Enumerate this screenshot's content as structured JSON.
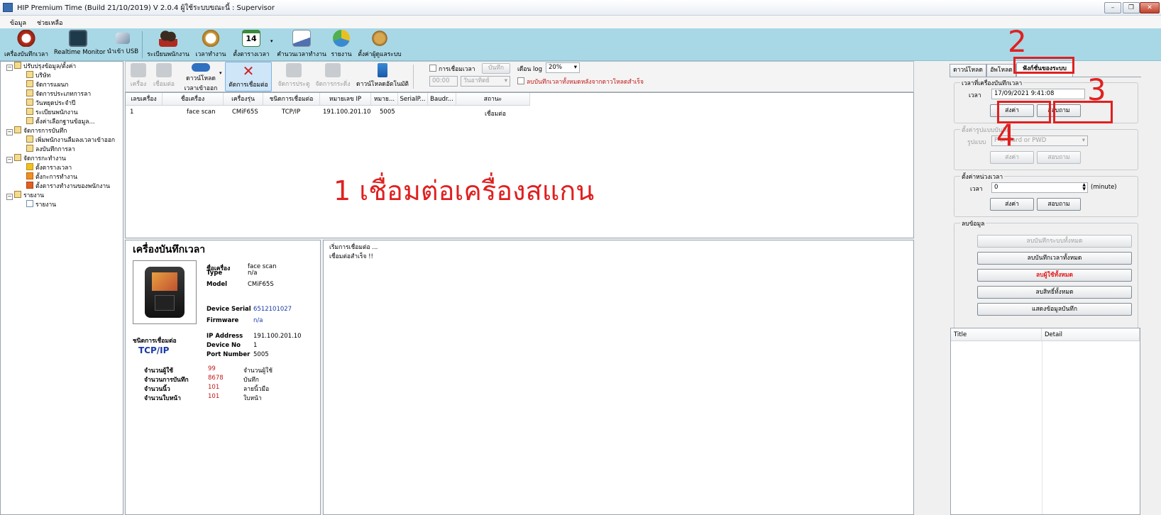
{
  "window": {
    "title": "HIP Premium Time (Build 21/10/2019) V 2.0.4  ผู้ใช้ระบบขณะนี้ : Supervisor",
    "min": "–",
    "max": "❐",
    "close": "✕"
  },
  "menu": [
    "ข้อมูล",
    "ช่วยเหลือ"
  ],
  "toolbar": [
    "เครื่องบันทึกเวลา",
    "Realtime Monitor",
    "นำเข้า USB",
    "ระเบียนพนักงาน",
    "เวลาทำงาน",
    "ตั้งตารางเวลา",
    "คำนวนเวลาทำงาน",
    "รายงาน",
    "ตั้งค่าผู้ดูแลระบบ"
  ],
  "toolbar_badge": "14",
  "tree": [
    {
      "label": "ปรับปรุงข้อมูล/ตั้งค่า",
      "level": 0
    },
    {
      "label": "บริษัท",
      "level": 1
    },
    {
      "label": "จัดการแผนก",
      "level": 1
    },
    {
      "label": "จัดการประเภทการลา",
      "level": 1
    },
    {
      "label": "วันหยุดประจำปี",
      "level": 1
    },
    {
      "label": "ระเบียนพนักงาน",
      "level": 1
    },
    {
      "label": "ตั้งค่าเลือกฐานข้อมูล...",
      "level": 1
    },
    {
      "label": "จัดการการบันทึก",
      "level": 0
    },
    {
      "label": "เพิ่มพนักงานลืมลงเวลาเข้าออก",
      "level": 1
    },
    {
      "label": "ลงบันทึกการลา",
      "level": 1
    },
    {
      "label": "จัดการกะทำงาน",
      "level": 0
    },
    {
      "label": "ตั้งตารางเวลา",
      "level": 1
    },
    {
      "label": "ตั้งกะการทำงาน",
      "level": 1
    },
    {
      "label": "ตั้งตารางทำงานของพนักงาน",
      "level": 1
    },
    {
      "label": "รายงาน",
      "level": 0
    },
    {
      "label": "รายงาน",
      "level": 1
    }
  ],
  "devtools": {
    "add": "เครื่อง",
    "connect": "เชื่อมต่อ",
    "download_1": "ดาวน์โหลด",
    "download_2": "เวลาเข้าออก",
    "disconnect": "ตัดการเชื่อมต่อ",
    "door": "จัดการประตู",
    "bell": "จัดการกระดิ่ง",
    "autodl": "ดาวน์โหลดอัตโนมัติ",
    "time_conn": "การเชื่อมเวลา",
    "record_btn": "บันทึก",
    "month_log": "เดือน log",
    "percent": "20%",
    "time_val": "00:00",
    "day_val": "วันอาทิตย์",
    "delete_chk": "ลบบันทึกเวลาทั้งหมดหลังจากดาวโหลดสำเร็จ"
  },
  "grid": {
    "headers": [
      "เลขเครื่อง",
      "ชื่อเครื่อง",
      "เครื่องรุ่น",
      "ชนิดการเชื่อมต่อ",
      "หมายเลข IP",
      "หมาย...",
      "SerialP...",
      "Baudr...",
      "สถานะ"
    ],
    "rows": [
      [
        "1",
        "face scan",
        "CMiF65S",
        "TCP/IP",
        "191.100.201.10",
        "5005",
        "",
        "",
        "เชื่อมต่อ"
      ]
    ]
  },
  "annotation_text": "1 เชื่อมต่อเครื่องสแกน",
  "device": {
    "title": "เครื่องบันทึกเวลา",
    "name_label": "ชื่อเครื่อง",
    "name": "face scan",
    "type_label": "Type",
    "type": "n/a",
    "model_label": "Model",
    "model": "CMiF65S",
    "serial_label": "Device Serial",
    "serial": "6512101027",
    "firmware_label": "Firmware",
    "firmware": "n/a",
    "conn_label": "ชนิดการเชื่อมต่อ",
    "conn": "TCP/IP",
    "ip_label": "IP Address",
    "ip": "191.100.201.10",
    "devno_label": "Device No",
    "devno": "1",
    "port_label": "Port Number",
    "port": "5005",
    "stats": [
      {
        "label": "จำนวนผู้ใช้",
        "value": "99",
        "unit": "จำนวนผู้ใช้"
      },
      {
        "label": "จำนวนการบันทึก",
        "value": "8678",
        "unit": "บันทึก"
      },
      {
        "label": "จำนวนนิ้ว",
        "value": "101",
        "unit": "ลายนิ้วมือ"
      },
      {
        "label": "จำนวนใบหน้า",
        "value": "101",
        "unit": "ใบหน้า"
      }
    ]
  },
  "log": [
    "เริ่มการเชื่อมต่อ ...",
    "เชื่อมต่อสำเร็จ !!"
  ],
  "rtabs": [
    "ดาวน์โหลด",
    "อัพโหลด",
    "ฟังก์ชั่นของระบบ"
  ],
  "time_group": {
    "title": "เวลาที่เครื่องบันทึกเวลา",
    "label": "เวลา",
    "value": "17/09/2021 9:41:08",
    "send": "ส่งค่า",
    "query": "สอบถาม"
  },
  "format_group": {
    "title": "ตั้งค่ารูปแบบบันทึก",
    "label": "รูปแบบ",
    "value": "P or Card or PWD",
    "send": "ส่งค่า",
    "query": "สอบถาม"
  },
  "delay_group": {
    "title": "ตั้งค่าหน่วงเวลา",
    "label": "เวลา",
    "value": "0",
    "unit": "(minute)",
    "send": "ส่งค่า",
    "query": "สอบถาม"
  },
  "delete_group": {
    "title": "ลบข้อมูล",
    "buttons": [
      "ลบบันทึกระบบทั้งหมด",
      "ลบบันทึกเวลาทั้งหมด",
      "ลบผู้ใช้ทั้งหมด",
      "ลบสิทธิ์ทั้งหมด",
      "แสดงข้อมูลบันทึก"
    ]
  },
  "info_table": {
    "headers": [
      "Title",
      "Detail"
    ]
  },
  "steps": [
    "2",
    "3",
    "4"
  ],
  "colors": {
    "annotation": "#e02020",
    "toolbar": "#a8d8e6"
  }
}
